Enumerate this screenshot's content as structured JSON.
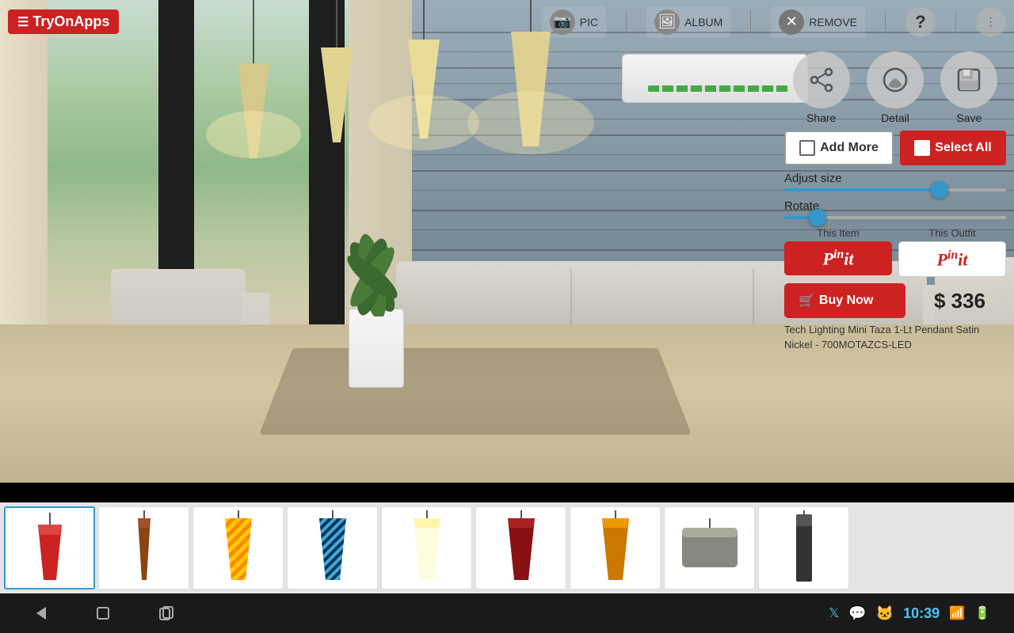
{
  "app": {
    "name": "TryOnApps",
    "logo_text": "TryOnApps"
  },
  "topbar": {
    "pic_label": "PIC",
    "album_label": "ALBUM",
    "remove_label": "REMOVE"
  },
  "icons": {
    "share": "share-icon",
    "detail": "detail-icon",
    "save": "save-icon"
  },
  "actions": {
    "share_label": "Share",
    "detail_label": "Detail",
    "save_label": "Save",
    "add_more_label": "Add More",
    "select_all_label": "Select All",
    "adjust_size_label": "Adjust size",
    "rotate_label": "Rotate",
    "this_item_label": "This Item",
    "this_outfit_label": "This Outfit",
    "pinit_label": "Pinit",
    "buy_now_label": "Buy Now"
  },
  "sliders": {
    "size_value": 70,
    "rotate_value": 15
  },
  "product": {
    "price": "$ 336",
    "name": "Tech Lighting Mini Taza 1-Lt Pendant Satin Nickel - 700MOTAZCS-LED"
  },
  "android": {
    "time": "10:39"
  },
  "carousel": {
    "items": [
      {
        "id": 1,
        "type": "cone",
        "color": "red",
        "label": "lamp-1"
      },
      {
        "id": 2,
        "type": "cone",
        "color": "brown",
        "label": "lamp-2"
      },
      {
        "id": 3,
        "type": "cone",
        "color": "yellow-stripe",
        "label": "lamp-3"
      },
      {
        "id": 4,
        "type": "cone",
        "color": "teal",
        "label": "lamp-4"
      },
      {
        "id": 5,
        "type": "cone",
        "color": "cream",
        "label": "lamp-5"
      },
      {
        "id": 6,
        "type": "cone",
        "color": "dark-red",
        "label": "lamp-6"
      },
      {
        "id": 7,
        "type": "cone",
        "color": "amber",
        "label": "lamp-7"
      },
      {
        "id": 8,
        "type": "drum",
        "color": "drum",
        "label": "lamp-8"
      },
      {
        "id": 9,
        "type": "cylinder",
        "color": "dark-cylinder",
        "label": "lamp-9"
      }
    ]
  }
}
